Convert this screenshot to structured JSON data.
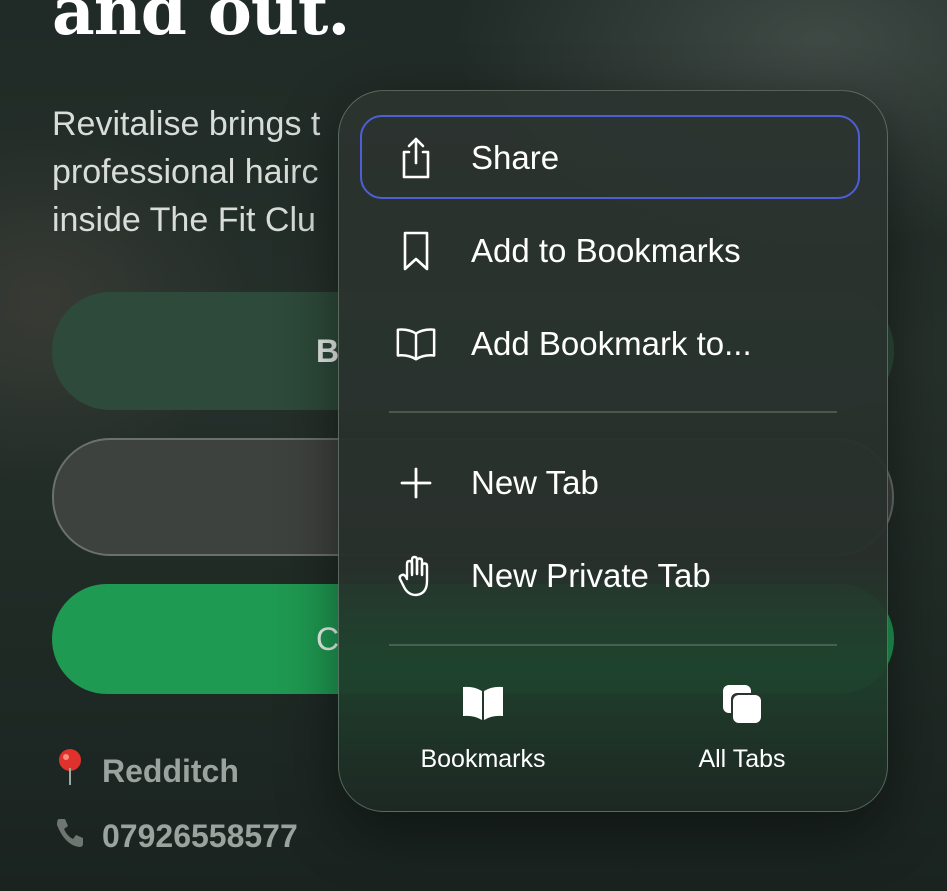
{
  "page": {
    "headline": "and out.",
    "intro_lines": [
      "Revitalise brings t",
      "professional hairc",
      "inside The Fit Clu"
    ],
    "buttons": [
      "B",
      "",
      "C"
    ],
    "location": "Redditch",
    "phone": "07926558577"
  },
  "menu": {
    "items": [
      {
        "label": "Share",
        "icon": "share-icon"
      },
      {
        "label": "Add to Bookmarks",
        "icon": "bookmark-icon"
      },
      {
        "label": "Add Bookmark to...",
        "icon": "book-open-icon"
      },
      {
        "label": "New Tab",
        "icon": "plus-icon"
      },
      {
        "label": "New Private Tab",
        "icon": "hand-icon"
      }
    ],
    "bottom": [
      {
        "label": "Bookmarks",
        "icon": "bookmarks-book-icon"
      },
      {
        "label": "All Tabs",
        "icon": "tabs-icon"
      }
    ]
  },
  "colors": {
    "highlight": "#4e5ed6",
    "green_button": "#1f9a52"
  }
}
